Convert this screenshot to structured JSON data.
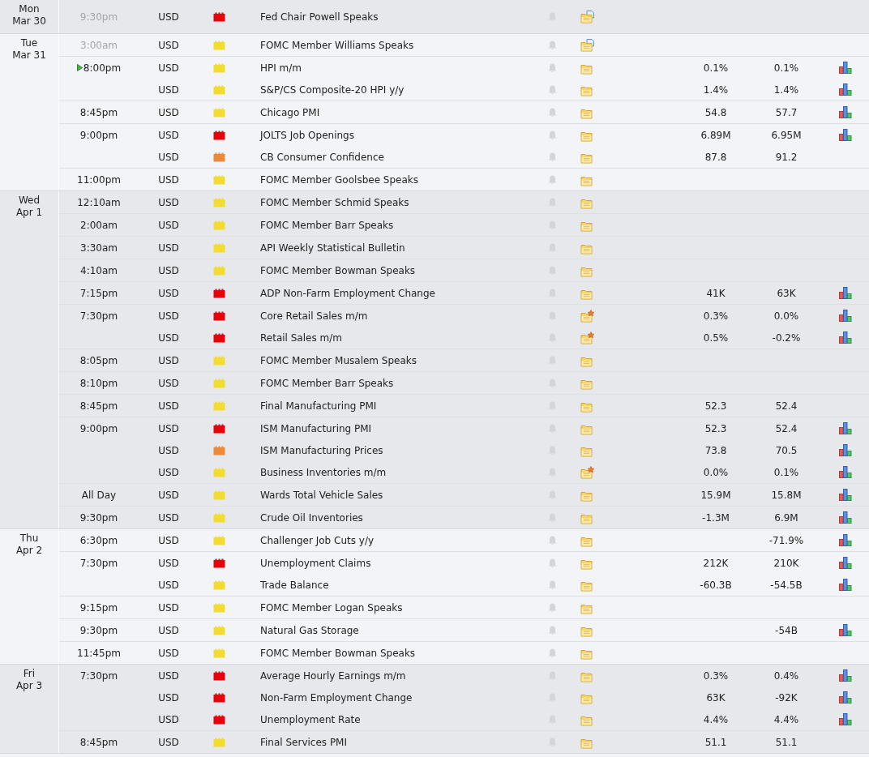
{
  "days": [
    {
      "weekday": "Mon",
      "date": "Mar 30",
      "groups": [
        {
          "time": "9:30pm",
          "past": true,
          "next": false,
          "events": [
            {
              "currency": "USD",
              "color": "#e8000b",
              "title": "Fed Chair Powell Speaks",
              "updated": true,
              "new": false,
              "graph": false
            }
          ]
        }
      ]
    },
    {
      "weekday": "Tue",
      "date": "Mar 31",
      "groups": [
        {
          "time": "3:00am",
          "past": true,
          "next": false,
          "events": [
            {
              "currency": "USD",
              "color": "#f3dc30",
              "title": "FOMC Member Williams Speaks",
              "updated": true,
              "new": false,
              "graph": false
            }
          ]
        },
        {
          "time": "8:00pm",
          "past": false,
          "next": true,
          "events": [
            {
              "currency": "USD",
              "color": "#f3dc30",
              "title": "HPI m/m",
              "updated": false,
              "new": false,
              "forecast": "0.1%",
              "previous": "0.1%",
              "graph": true
            },
            {
              "currency": "USD",
              "color": "#f3dc30",
              "title": "S&P/CS Composite-20 HPI y/y",
              "updated": false,
              "new": false,
              "forecast": "1.4%",
              "previous": "1.4%",
              "graph": true
            }
          ]
        },
        {
          "time": "8:45pm",
          "past": false,
          "next": false,
          "events": [
            {
              "currency": "USD",
              "color": "#f3dc30",
              "title": "Chicago PMI",
              "updated": false,
              "new": false,
              "forecast": "54.8",
              "previous": "57.7",
              "graph": true
            }
          ]
        },
        {
          "time": "9:00pm",
          "past": false,
          "next": false,
          "events": [
            {
              "currency": "USD",
              "color": "#e8000b",
              "title": "JOLTS Job Openings",
              "updated": false,
              "new": false,
              "forecast": "6.89M",
              "previous": "6.95M",
              "graph": true
            },
            {
              "currency": "USD",
              "color": "#ec8a3a",
              "title": "CB Consumer Confidence",
              "updated": false,
              "new": false,
              "forecast": "87.8",
              "previous": "91.2",
              "graph": false
            }
          ]
        },
        {
          "time": "11:00pm",
          "past": false,
          "next": false,
          "events": [
            {
              "currency": "USD",
              "color": "#f3dc30",
              "title": "FOMC Member Goolsbee Speaks",
              "updated": false,
              "new": false,
              "graph": false
            }
          ]
        }
      ]
    },
    {
      "weekday": "Wed",
      "date": "Apr 1",
      "groups": [
        {
          "time": "12:10am",
          "past": false,
          "next": false,
          "events": [
            {
              "currency": "USD",
              "color": "#f3dc30",
              "title": "FOMC Member Schmid Speaks",
              "updated": false,
              "new": false,
              "graph": false
            }
          ]
        },
        {
          "time": "2:00am",
          "past": false,
          "next": false,
          "events": [
            {
              "currency": "USD",
              "color": "#f3dc30",
              "title": "FOMC Member Barr Speaks",
              "updated": false,
              "new": false,
              "graph": false
            }
          ]
        },
        {
          "time": "3:30am",
          "past": false,
          "next": false,
          "events": [
            {
              "currency": "USD",
              "color": "#f3dc30",
              "title": "API Weekly Statistical Bulletin",
              "updated": false,
              "new": false,
              "graph": false
            }
          ]
        },
        {
          "time": "4:10am",
          "past": false,
          "next": false,
          "events": [
            {
              "currency": "USD",
              "color": "#f3dc30",
              "title": "FOMC Member Bowman Speaks",
              "updated": false,
              "new": false,
              "graph": false
            }
          ]
        },
        {
          "time": "7:15pm",
          "past": false,
          "next": false,
          "events": [
            {
              "currency": "USD",
              "color": "#e8000b",
              "title": "ADP Non-Farm Employment Change",
              "updated": false,
              "new": false,
              "forecast": "41K",
              "previous": "63K",
              "graph": true
            }
          ]
        },
        {
          "time": "7:30pm",
          "past": false,
          "next": false,
          "events": [
            {
              "currency": "USD",
              "color": "#e8000b",
              "title": "Core Retail Sales m/m",
              "updated": false,
              "new": true,
              "forecast": "0.3%",
              "previous": "0.0%",
              "graph": true
            },
            {
              "currency": "USD",
              "color": "#e8000b",
              "title": "Retail Sales m/m",
              "updated": false,
              "new": true,
              "forecast": "0.5%",
              "previous": "-0.2%",
              "graph": true
            }
          ]
        },
        {
          "time": "8:05pm",
          "past": false,
          "next": false,
          "events": [
            {
              "currency": "USD",
              "color": "#f3dc30",
              "title": "FOMC Member Musalem Speaks",
              "updated": false,
              "new": false,
              "graph": false
            }
          ]
        },
        {
          "time": "8:10pm",
          "past": false,
          "next": false,
          "events": [
            {
              "currency": "USD",
              "color": "#f3dc30",
              "title": "FOMC Member Barr Speaks",
              "updated": false,
              "new": false,
              "graph": false
            }
          ]
        },
        {
          "time": "8:45pm",
          "past": false,
          "next": false,
          "events": [
            {
              "currency": "USD",
              "color": "#f3dc30",
              "title": "Final Manufacturing PMI",
              "updated": false,
              "new": false,
              "forecast": "52.3",
              "previous": "52.4",
              "graph": false
            }
          ]
        },
        {
          "time": "9:00pm",
          "past": false,
          "next": false,
          "events": [
            {
              "currency": "USD",
              "color": "#e8000b",
              "title": "ISM Manufacturing PMI",
              "updated": false,
              "new": false,
              "forecast": "52.3",
              "previous": "52.4",
              "graph": true
            },
            {
              "currency": "USD",
              "color": "#ec8a3a",
              "title": "ISM Manufacturing Prices",
              "updated": false,
              "new": false,
              "forecast": "73.8",
              "previous": "70.5",
              "graph": true
            },
            {
              "currency": "USD",
              "color": "#f3dc30",
              "title": "Business Inventories m/m",
              "updated": false,
              "new": true,
              "forecast": "0.0%",
              "previous": "0.1%",
              "graph": true
            }
          ]
        },
        {
          "time": "All Day",
          "past": false,
          "next": false,
          "events": [
            {
              "currency": "USD",
              "color": "#f3dc30",
              "title": "Wards Total Vehicle Sales",
              "updated": false,
              "new": false,
              "forecast": "15.9M",
              "previous": "15.8M",
              "graph": true
            }
          ]
        },
        {
          "time": "9:30pm",
          "past": false,
          "next": false,
          "events": [
            {
              "currency": "USD",
              "color": "#f3dc30",
              "title": "Crude Oil Inventories",
              "updated": false,
              "new": false,
              "forecast": "-1.3M",
              "previous": "6.9M",
              "graph": true
            }
          ]
        }
      ]
    },
    {
      "weekday": "Thu",
      "date": "Apr 2",
      "groups": [
        {
          "time": "6:30pm",
          "past": false,
          "next": false,
          "events": [
            {
              "currency": "USD",
              "color": "#f3dc30",
              "title": "Challenger Job Cuts y/y",
              "updated": false,
              "new": false,
              "previous": "-71.9%",
              "graph": true
            }
          ]
        },
        {
          "time": "7:30pm",
          "past": false,
          "next": false,
          "events": [
            {
              "currency": "USD",
              "color": "#e8000b",
              "title": "Unemployment Claims",
              "updated": false,
              "new": false,
              "forecast": "212K",
              "previous": "210K",
              "graph": true
            },
            {
              "currency": "USD",
              "color": "#f3dc30",
              "title": "Trade Balance",
              "updated": false,
              "new": false,
              "forecast": "-60.3B",
              "previous": "-54.5B",
              "graph": true
            }
          ]
        },
        {
          "time": "9:15pm",
          "past": false,
          "next": false,
          "events": [
            {
              "currency": "USD",
              "color": "#f3dc30",
              "title": "FOMC Member Logan Speaks",
              "updated": false,
              "new": false,
              "graph": false
            }
          ]
        },
        {
          "time": "9:30pm",
          "past": false,
          "next": false,
          "events": [
            {
              "currency": "USD",
              "color": "#f3dc30",
              "title": "Natural Gas Storage",
              "updated": false,
              "new": false,
              "previous": "-54B",
              "graph": true
            }
          ]
        },
        {
          "time": "11:45pm",
          "past": false,
          "next": false,
          "events": [
            {
              "currency": "USD",
              "color": "#f3dc30",
              "title": "FOMC Member Bowman Speaks",
              "updated": false,
              "new": false,
              "graph": false
            }
          ]
        }
      ]
    },
    {
      "weekday": "Fri",
      "date": "Apr 3",
      "groups": [
        {
          "time": "7:30pm",
          "past": false,
          "next": false,
          "events": [
            {
              "currency": "USD",
              "color": "#e8000b",
              "title": "Average Hourly Earnings m/m",
              "updated": false,
              "new": false,
              "forecast": "0.3%",
              "previous": "0.4%",
              "graph": true
            },
            {
              "currency": "USD",
              "color": "#e8000b",
              "title": "Non-Farm Employment Change",
              "updated": false,
              "new": false,
              "forecast": "63K",
              "previous": "-92K",
              "graph": true
            },
            {
              "currency": "USD",
              "color": "#e8000b",
              "title": "Unemployment Rate",
              "updated": false,
              "new": false,
              "forecast": "4.4%",
              "previous": "4.4%",
              "graph": true
            }
          ]
        },
        {
          "time": "8:45pm",
          "past": false,
          "next": false,
          "events": [
            {
              "currency": "USD",
              "color": "#f3dc30",
              "title": "Final Services PMI",
              "updated": false,
              "new": false,
              "forecast": "51.1",
              "previous": "51.1",
              "graph": false
            }
          ]
        }
      ]
    }
  ]
}
